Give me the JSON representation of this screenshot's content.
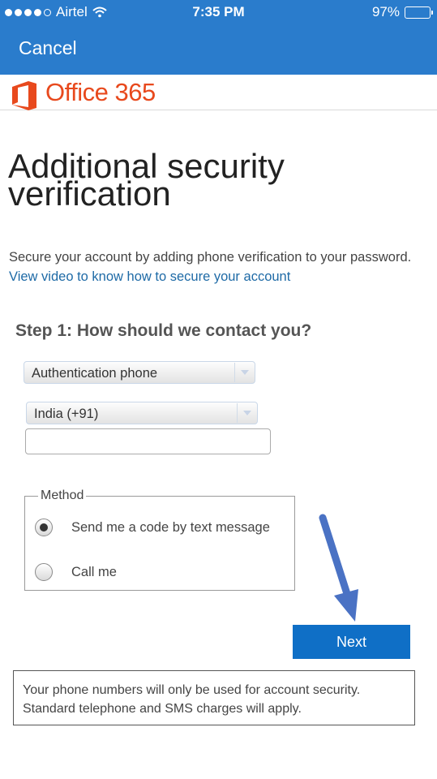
{
  "status_bar": {
    "carrier": "Airtel",
    "time": "7:35 PM",
    "battery": "97%",
    "battery_level": 0.97,
    "icons": [
      "signal-dots-icon",
      "wifi-icon",
      "battery-icon"
    ]
  },
  "nav": {
    "cancel_label": "Cancel"
  },
  "brand": {
    "name": "Office 365",
    "color": "#e8491d"
  },
  "page": {
    "title": "Additional security verification",
    "intro_text": "Secure your account by adding phone verification to your password.",
    "intro_link": "View video to know how to secure your account"
  },
  "step1": {
    "heading": "Step 1: How should we contact you?",
    "contact_method_select": {
      "selected": "Authentication phone"
    },
    "country_select": {
      "selected": "India (+91)"
    },
    "phone_input": {
      "value": "",
      "placeholder": ""
    }
  },
  "method": {
    "legend": "Method",
    "options": [
      {
        "label": "Send me a code by text message",
        "selected": true
      },
      {
        "label": "Call me",
        "selected": false
      }
    ]
  },
  "actions": {
    "next_label": "Next"
  },
  "notice": {
    "line1": "Your phone numbers will only be used for account security.",
    "line2": "Standard telephone and SMS charges will apply."
  },
  "colors": {
    "header_bg": "#2a7ccc",
    "primary_button": "#0f6fc6",
    "link": "#1e6aa6",
    "annotation_arrow": "#4a72c4"
  }
}
